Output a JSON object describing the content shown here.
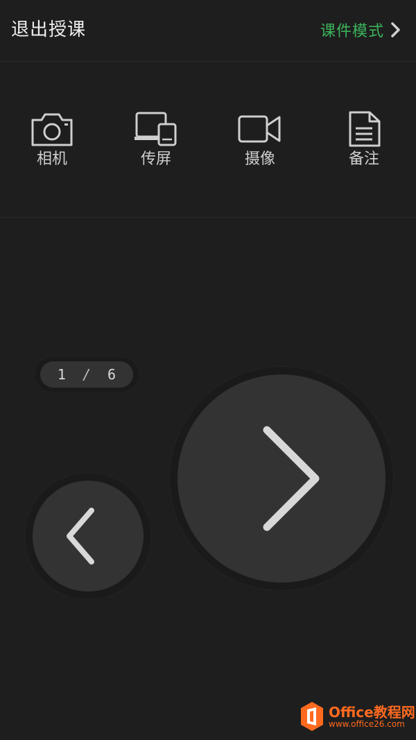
{
  "header": {
    "exit_label": "退出授课",
    "mode_label": "课件模式",
    "mode_color": "#3bb45b"
  },
  "toolbar": {
    "items": [
      {
        "label": "相机",
        "icon": "camera-icon"
      },
      {
        "label": "传屏",
        "icon": "screen-cast-icon"
      },
      {
        "label": "摄像",
        "icon": "video-camera-icon"
      },
      {
        "label": "备注",
        "icon": "notes-icon"
      }
    ]
  },
  "pager": {
    "current": "1",
    "separator": "/",
    "total": "6"
  },
  "navigation": {
    "prev_icon": "chevron-left-icon",
    "next_icon": "chevron-right-icon"
  },
  "watermark": {
    "title": "Office教程网",
    "url": "www.office26.com",
    "color": "#ff6a1f"
  },
  "colors": {
    "background": "#1e1e1e",
    "button": "#333333",
    "icon": "#cfcfcf",
    "accent": "#3bb45b"
  }
}
